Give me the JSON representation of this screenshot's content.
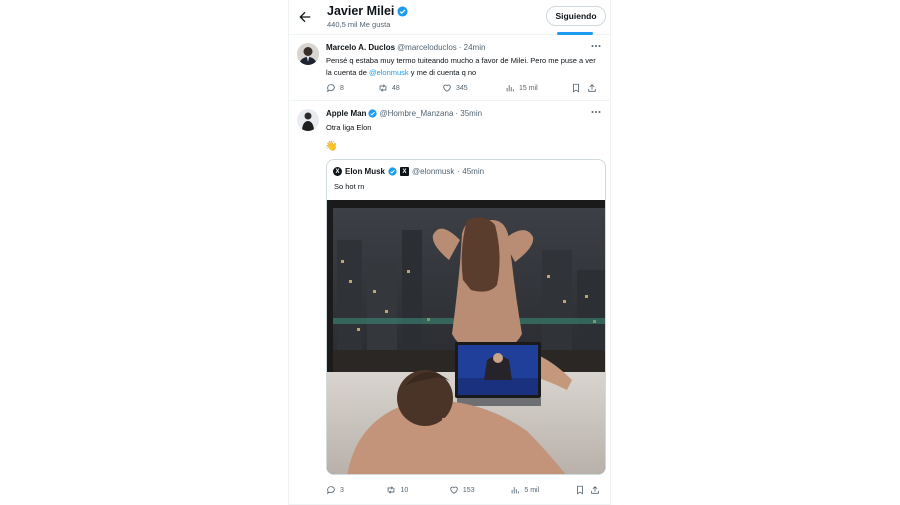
{
  "header": {
    "name": "Javier Milei",
    "likes": "440,5 mil Me gusta",
    "follow_label": "Siguiendo"
  },
  "tweets": [
    {
      "name": "Marcelo A. Duclos",
      "handle": "@marceloduclos",
      "time": "· 24min",
      "text_before": "Pensé q estaba muy termo tuiteando mucho a favor de Milei. Pero me puse a ver la cuenta de ",
      "mention": "@elonmusk",
      "text_after": " y me di cuenta q no",
      "replies": "8",
      "retweets": "48",
      "likes": "345",
      "views": "15 mil"
    },
    {
      "name": "Apple Man",
      "handle": "@Hombre_Manzana",
      "time": "· 35min",
      "text": "Otra liga Elon",
      "emoji": "👋",
      "replies": "3",
      "retweets": "10",
      "likes": "153",
      "views": "5 mil",
      "quote": {
        "name": "Elon Musk",
        "handle": "@elonmusk",
        "time": "· 45min",
        "text": "So hot rn"
      }
    }
  ],
  "colors": {
    "accent": "#1d9bf0",
    "verified": "#1d9bf0",
    "muted": "#536471",
    "border": "#eff3f4"
  },
  "icons": {
    "back": "arrow-left-icon",
    "verified": "verified-badge-icon",
    "more": "more-icon",
    "reply": "reply-icon",
    "retweet": "retweet-icon",
    "like": "heart-icon",
    "views": "views-icon",
    "bookmark": "bookmark-icon",
    "share": "share-icon"
  }
}
